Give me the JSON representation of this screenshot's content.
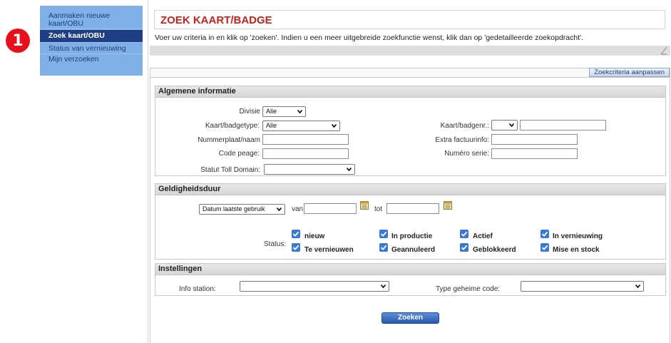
{
  "step_badge": "1",
  "sidebar": {
    "items": [
      {
        "label": "Aanmaken nieuwe kaart/OBU"
      },
      {
        "label": "Zoek kaart/OBU"
      },
      {
        "label": "Status van vernieuwing"
      },
      {
        "label": "Mijn verzoeken"
      }
    ],
    "active_index": 1
  },
  "page": {
    "title": "ZOEK KAART/BADGE",
    "intro": "Voer uw criteria in en klik op 'zoeken'. Indien u een meer uitgebreide zoekfunctie wenst, klik dan op 'gedetailleerde zoekopdracht'.",
    "adjust_button": "Zoekcriteria aanpassen"
  },
  "general": {
    "title": "Algemene informatie",
    "divisie": {
      "label": "Divisie",
      "value": "Alle"
    },
    "kaarttype": {
      "label": "Kaart/badgetype:",
      "value": "Alle"
    },
    "nummerplaat": {
      "label": "Nummerplaat/naam",
      "value": ""
    },
    "code_peage": {
      "label": "Code peage:",
      "value": ""
    },
    "statut_toll": {
      "label": "Statut Toll Domain:",
      "value": ""
    },
    "kaartnr": {
      "label": "Kaart/badgenr.:",
      "prefix_value": "",
      "value": ""
    },
    "extra_factuur": {
      "label": "Extra factuurinfo:",
      "value": ""
    },
    "numero_serie": {
      "label": "Numéro serie:",
      "value": ""
    }
  },
  "validity": {
    "title": "Geldigheidsduur",
    "date_type": "Datum laatste gebruik",
    "van_label": "van",
    "tot_label": "tot",
    "van_value": "",
    "tot_value": "",
    "status_label": "Status:",
    "statuses": [
      {
        "label": "nieuw",
        "checked": true
      },
      {
        "label": "In productie",
        "checked": true
      },
      {
        "label": "Actief",
        "checked": true
      },
      {
        "label": "In vernieuwing",
        "checked": true
      },
      {
        "label": "Te vernieuwen",
        "checked": true
      },
      {
        "label": "Geannuleerd",
        "checked": true
      },
      {
        "label": "Geblokkeerd",
        "checked": true
      },
      {
        "label": "Mise en stock",
        "checked": true
      }
    ]
  },
  "settings": {
    "title": "Instellingen",
    "info_station": {
      "label": "Info station:",
      "value": ""
    },
    "secret_code": {
      "label": "Type geheime code:",
      "value": ""
    }
  },
  "search_button": "Zoeken",
  "colors": {
    "title_red": "#c8211d",
    "sidebar_bg": "#7fb1e6",
    "sidebar_active": "#1f3f84",
    "checkbox_blue": "#3a78d4",
    "badge_red": "#e8101a"
  }
}
